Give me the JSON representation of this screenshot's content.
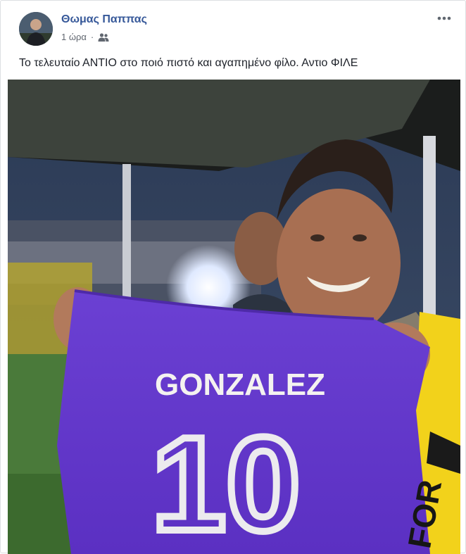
{
  "post": {
    "author_name": "Θωμας Παππας",
    "timestamp": "1 ώρα",
    "separator": "·",
    "audience_icon": "friends-icon",
    "more_icon": "more-options-icon",
    "text": "Το τελευταίο ΑΝΤΙΟ στο ποιό πιστό και αγαπημένο φίλο. Αντιο ΦΙΛΕ",
    "photo": {
      "jersey_name": "GONZALEZ",
      "jersey_number": "10",
      "scarf_text": "FOR",
      "jersey_color": "#6a3fd0",
      "scarf_color": "#f2d21b"
    }
  },
  "colors": {
    "author_link": "#365899",
    "meta_gray": "#616770",
    "border": "#dddfe2"
  }
}
